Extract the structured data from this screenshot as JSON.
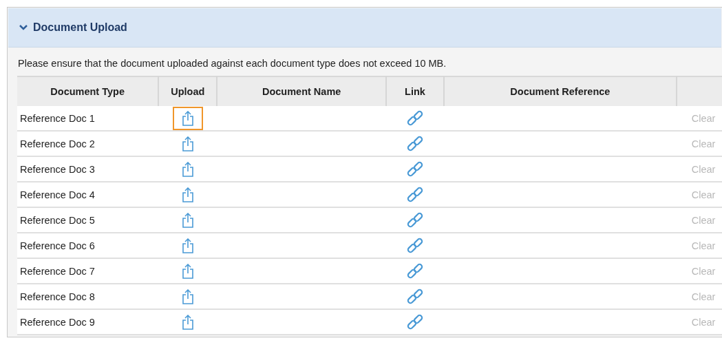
{
  "section": {
    "title": "Document Upload",
    "expanded": true
  },
  "note": "Please ensure that the document uploaded against each document type does not exceed 10 MB.",
  "table": {
    "columns": [
      "Document Type",
      "Upload",
      "Document Name",
      "Link",
      "Document Reference"
    ],
    "rows": [
      {
        "document_type": "Reference Doc 1",
        "upload_focused": true,
        "clear": "Clear",
        "clear_disabled": true
      },
      {
        "document_type": "Reference Doc 2",
        "upload_focused": false,
        "clear": "Clear",
        "clear_disabled": true
      },
      {
        "document_type": "Reference Doc 3",
        "upload_focused": false,
        "clear": "Clear",
        "clear_disabled": true
      },
      {
        "document_type": "Reference Doc 4",
        "upload_focused": false,
        "clear": "Clear",
        "clear_disabled": true
      },
      {
        "document_type": "Reference Doc 5",
        "upload_focused": false,
        "clear": "Clear",
        "clear_disabled": true
      },
      {
        "document_type": "Reference Doc 6",
        "upload_focused": false,
        "clear": "Clear",
        "clear_disabled": true
      },
      {
        "document_type": "Reference Doc 7",
        "upload_focused": false,
        "clear": "Clear",
        "clear_disabled": true
      },
      {
        "document_type": "Reference Doc 8",
        "upload_focused": false,
        "clear": "Clear",
        "clear_disabled": true
      },
      {
        "document_type": "Reference Doc 9",
        "upload_focused": false,
        "clear": "Clear",
        "clear_disabled": true
      }
    ]
  }
}
